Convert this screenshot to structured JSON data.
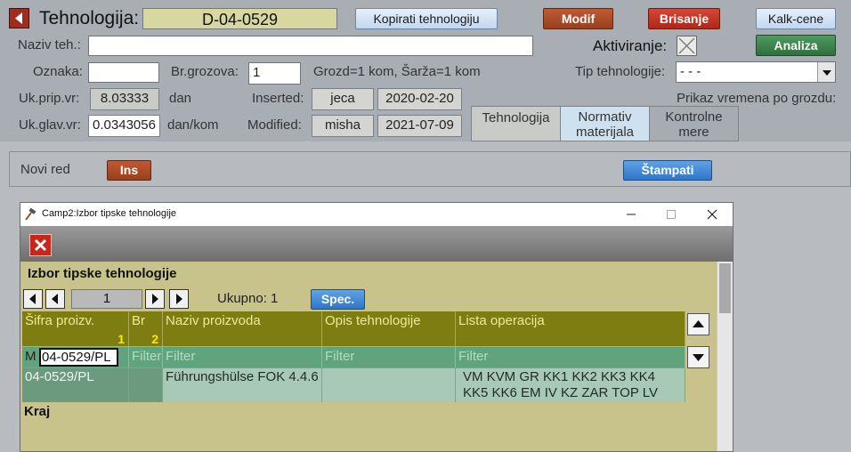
{
  "header": {
    "title": "Tehnologija:",
    "code": "D-04-0529",
    "btn_copy": "Kopirati tehnologiju",
    "btn_modif": "Modif",
    "btn_delete": "Brisanje",
    "btn_kalk": "Kalk-cene",
    "btn_analiza": "Analiza"
  },
  "form": {
    "naziv_label": "Naziv teh.:",
    "naziv_value": "",
    "aktiviranje_label": "Aktiviranje:",
    "oznaka_label": "Oznaka:",
    "oznaka_value": "",
    "brgrozova_label": "Br.grozova:",
    "brgrozova_value": "1",
    "grozd_info": "Grozd=1 kom, Šarža=1 kom",
    "tip_label": "Tip tehnologije:",
    "tip_value": "- - -",
    "ukprip_label": "Uk.prip.vr:",
    "ukprip_value": "8.03333",
    "ukprip_unit": "dan",
    "inserted_label": "Inserted:",
    "inserted_user": "jeca",
    "inserted_date": "2020-02-20",
    "prikaz_label": "Prikaz vremena po grozdu:",
    "ukglav_label": "Uk.glav.vr:",
    "ukglav_value": "0.0343056",
    "ukglav_unit": "dan/kom",
    "modified_label": "Modified:",
    "modified_user": "misha",
    "modified_date": "2021-07-09"
  },
  "tabs": [
    {
      "label": "Tehnologija"
    },
    {
      "label": "Normativ materijala"
    },
    {
      "label": "Kontrolne mere"
    }
  ],
  "subbar": {
    "novi_red_label": "Novi red",
    "ins_label": "Ins",
    "print_label": "Štampati"
  },
  "dialog": {
    "title": "Camp2:Izbor tipske tehnologije",
    "heading": "Izbor tipske tehnologije",
    "page_value": "1",
    "ukupno": "Ukupno: 1",
    "spec_label": "Spec.",
    "columns": [
      "Šifra proizv.",
      "Br",
      "Naziv proizvoda",
      "Opis tehnologije",
      "Lista operacija"
    ],
    "col_badges": [
      "1",
      "2"
    ],
    "filter_prefix": "M",
    "filter_sifra_value": "04-0529/PL",
    "filter_placeholder": "Filter",
    "rows": [
      {
        "sifra": "04-0529/PL",
        "br": "",
        "naziv": "Führungshülse FOK 4.4.6",
        "opis": "",
        "operacije": "VM KVM GR KK1 KK2 KK3 KK4 KK5 KK6 EM IV KZ ZAR TOP LV"
      }
    ],
    "footer": "Kraj"
  },
  "colors": {
    "bg": "#a9aeb4",
    "grid_header": "#7d7d12",
    "grid_filter": "#5fa47d",
    "grid_row": "#a9c9b7",
    "dialog_body": "#c7c38a"
  }
}
